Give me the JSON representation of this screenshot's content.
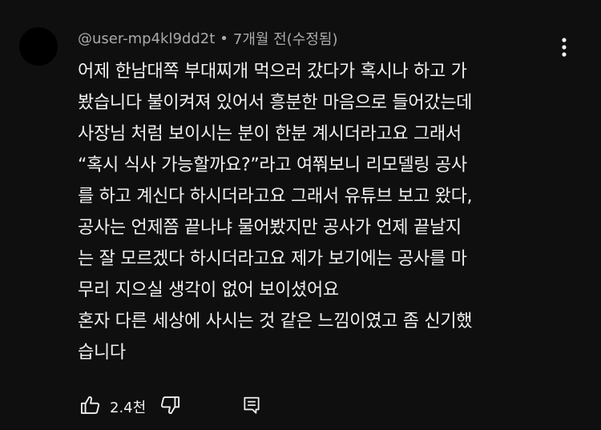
{
  "comment": {
    "author": "@user-mp4kl9dd2t",
    "separator": "•",
    "time": "7개월 전(수정됨)",
    "lines": [
      "어제 한남대쪽 부대찌개 먹으러 갔다가 혹시나 하고 가",
      "봤습니다 불이켜져 있어서 흥분한 마음으로 들어갔는데",
      "사장님 처럼 보이시는 분이 한분 계시더라고요 그래서",
      "“혹시 식사 가능할까요?”라고 여쭤보니 리모델링 공사",
      "를 하고 계신다 하시더라고요 그래서 유튜브 보고 왔다,",
      "공사는 언제쯤 끝나냐 물어봤지만 공사가 언제 끝날지",
      "는 잘 모르겠다 하시더라고요 제가 보기에는 공사를 마",
      "무리 지으실 생각이 없어 보이셨어요",
      "혼자 다른 세상에 사시는 것 같은 느낌이였고 좀 신기했",
      "습니다"
    ],
    "like_count": "2.4천"
  },
  "icons": {
    "more": "more-vert-icon",
    "like": "thumb-up-icon",
    "dislike": "thumb-down-icon",
    "reply": "comment-icon"
  },
  "colors": {
    "background": "#0f0f0f",
    "text_primary": "#f1f1f1",
    "text_secondary": "#aaaaaa"
  }
}
